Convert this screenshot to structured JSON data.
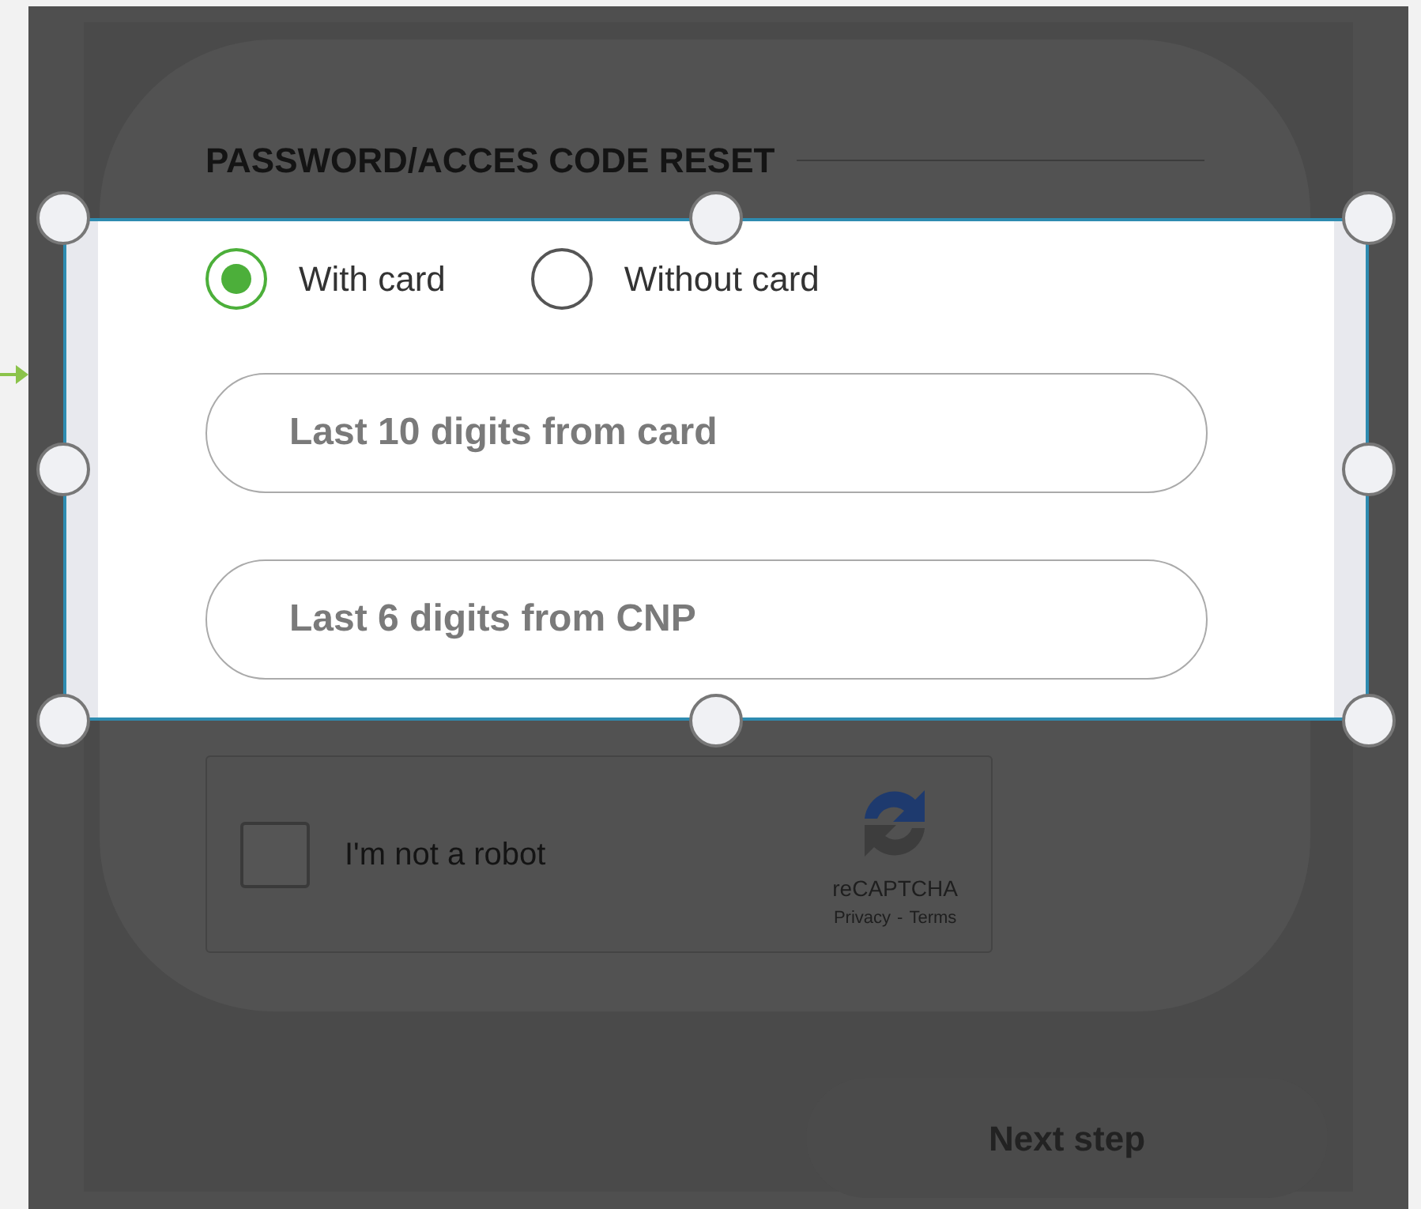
{
  "title": "PASSWORD/ACCES CODE RESET",
  "options": [
    {
      "label": "With card",
      "selected": true
    },
    {
      "label": "Without card",
      "selected": false
    }
  ],
  "fields": [
    {
      "placeholder": "Last 10 digits from card"
    },
    {
      "placeholder": "Last 6 digits from CNP"
    }
  ],
  "captcha": {
    "label": "I'm not a robot",
    "checked": false,
    "brand": "reCAPTCHA",
    "links": [
      "Privacy",
      "Terms"
    ],
    "separator": "-"
  },
  "next_button": {
    "label": "Next step"
  }
}
